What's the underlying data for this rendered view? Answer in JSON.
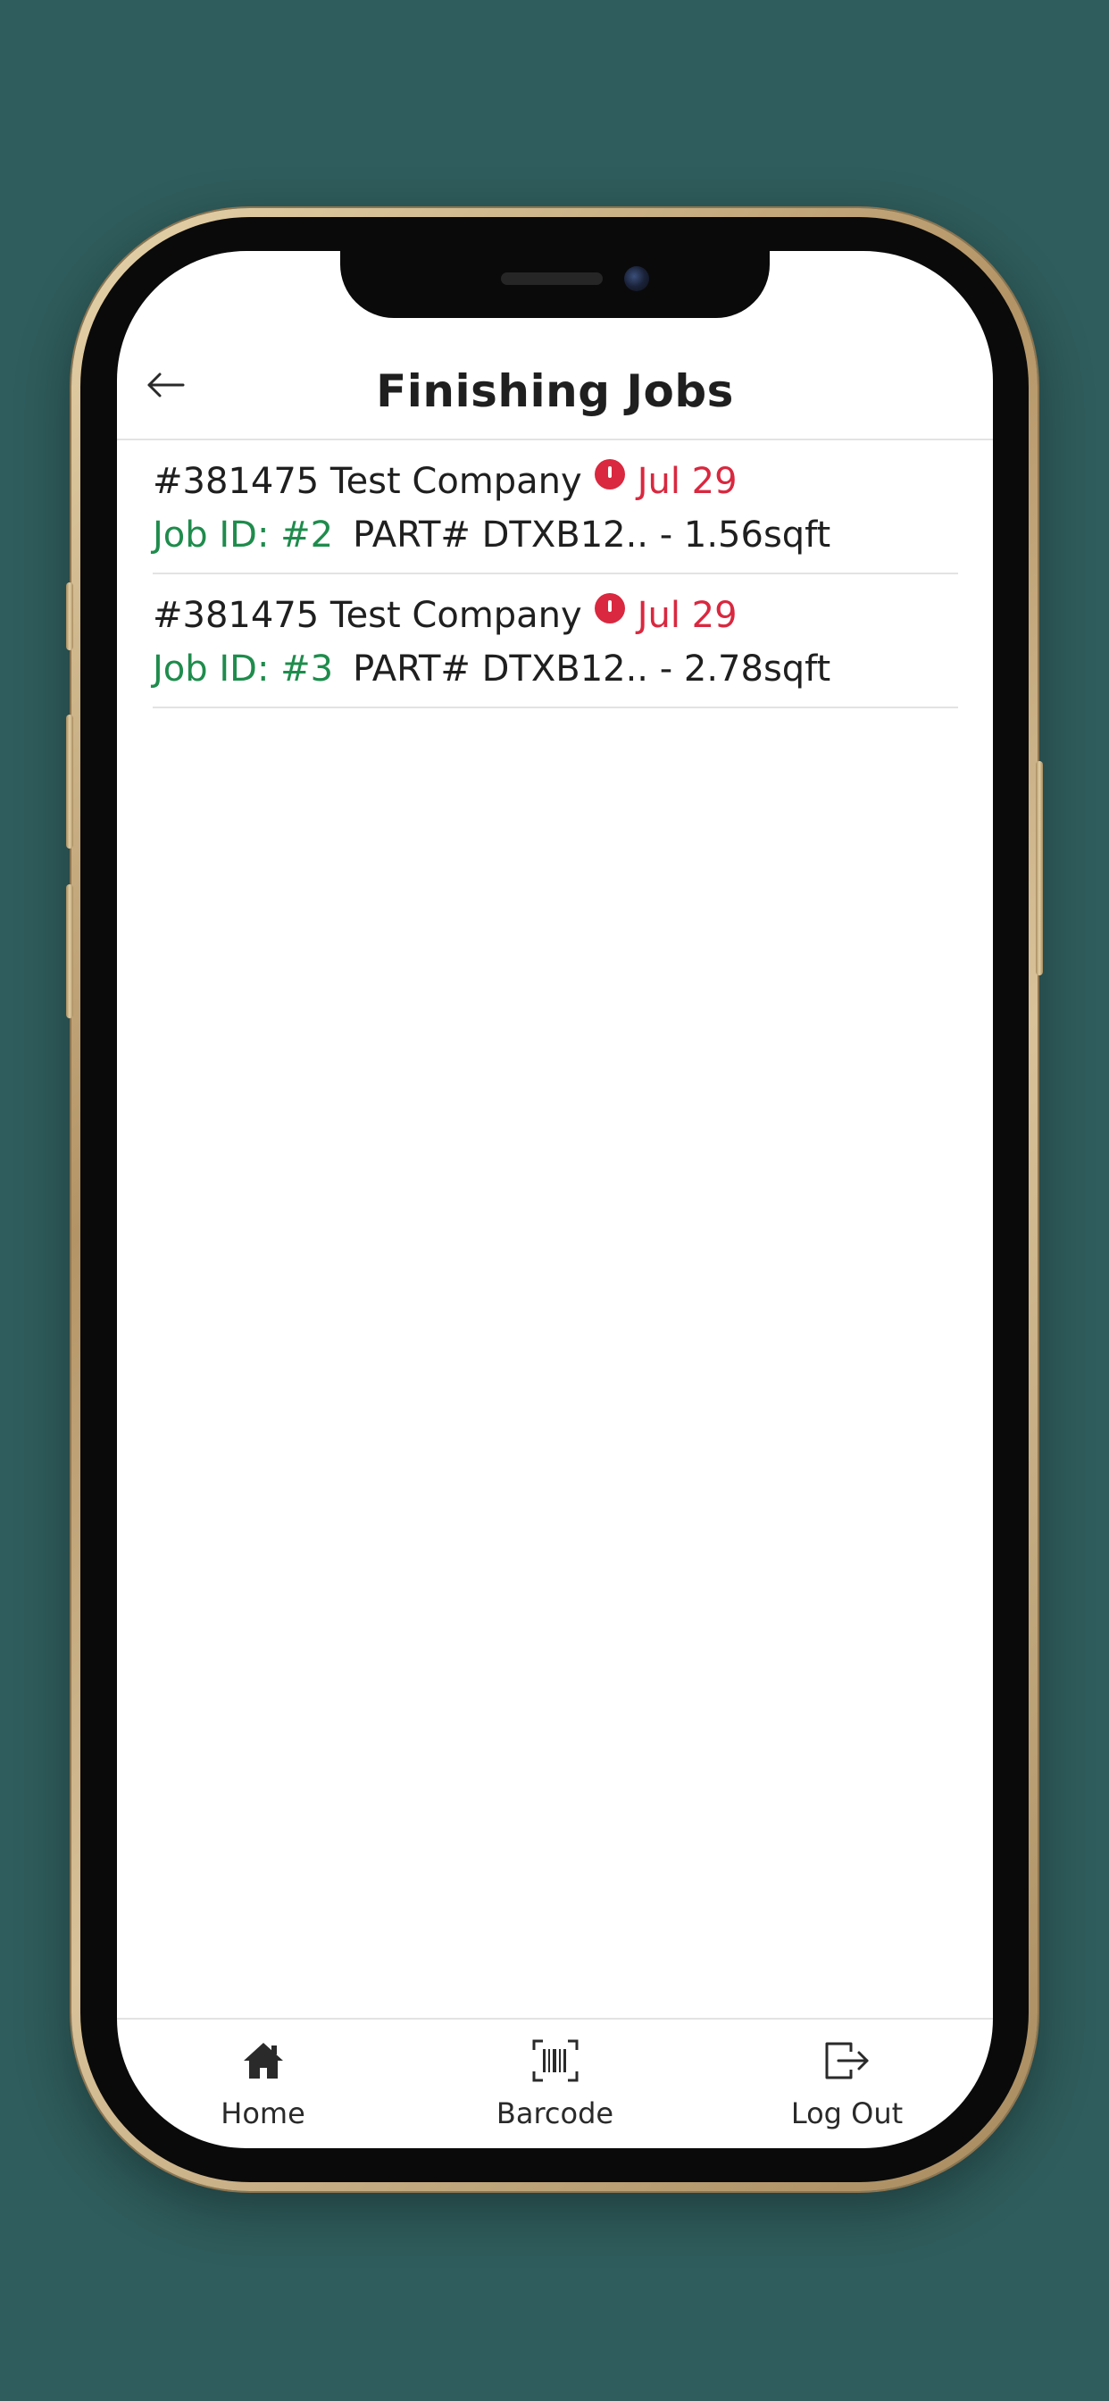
{
  "header": {
    "title": "Finishing Jobs",
    "back_icon": "arrow-left-icon"
  },
  "jobs": [
    {
      "order": "#381475 Test Company",
      "due_date": "Jul 29",
      "job_id": "Job ID: #2",
      "part": "PART# DTXB12.. - 1.56sqft"
    },
    {
      "order": "#381475 Test Company",
      "due_date": "Jul 29",
      "job_id": "Job ID: #3",
      "part": "PART# DTXB12.. - 2.78sqft"
    }
  ],
  "tab_bar": {
    "tabs": [
      {
        "label": "Home",
        "icon": "home-icon"
      },
      {
        "label": "Barcode",
        "icon": "barcode-icon"
      },
      {
        "label": "Log Out",
        "icon": "logout-icon"
      }
    ]
  },
  "colors": {
    "background": "#2f5c5c",
    "alert": "#d9283f",
    "job_id": "#1e8c4c",
    "text": "#1f1f1f"
  }
}
